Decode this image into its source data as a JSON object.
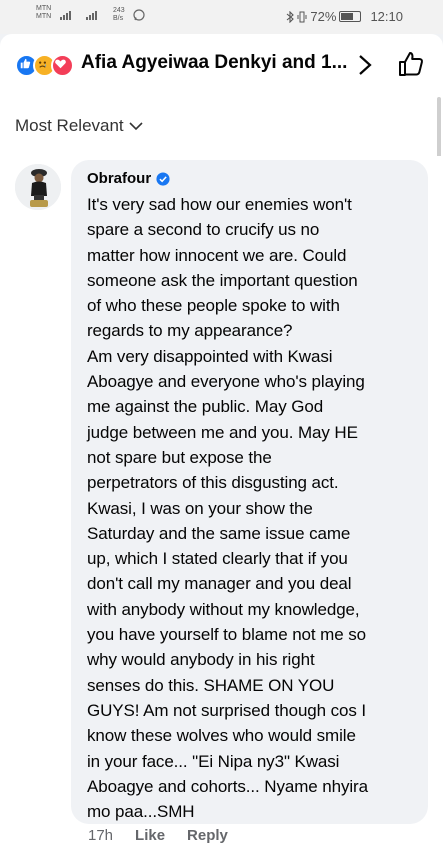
{
  "status_bar": {
    "carrier_top": "MTN",
    "carrier_bottom": "MTN",
    "data_speed_top": "243",
    "data_speed_bottom": "B/s",
    "battery_percent": "72%",
    "battery_level": 0.72,
    "time": "12:10"
  },
  "header": {
    "title": "Afia Agyeiwaa Denkyi and 1...",
    "reactions": [
      "like-icon",
      "sad-face-icon",
      "love-icon"
    ]
  },
  "sort": {
    "label": "Most Relevant"
  },
  "comment": {
    "author": "Obrafour",
    "verified": true,
    "lines": [
      "It's very sad how our enemies won't",
      "spare a second to crucify us  no",
      "matter how innocent we are. Could",
      "someone ask the important question",
      "of who these people spoke to with",
      "regards to my appearance?",
      "Am very disappointed with Kwasi",
      "Aboagye and everyone who's playing",
      "me against the public. May God",
      "judge between me and you. May HE",
      "not spare but expose the",
      "perpetrators of this disgusting act.",
      "Kwasi, I was on your show the",
      "Saturday and the same issue came",
      "up, which I stated clearly that if you",
      "don't call my manager and you deal",
      "with anybody without my knowledge,",
      "you have yourself to blame not me so",
      "why would anybody in his right",
      "senses do this. SHAME ON YOU",
      "GUYS! Am not surprised though cos I",
      "know these wolves who would smile",
      "in your face... \"Ei Nipa ny3\" Kwasi",
      "Aboagye and cohorts... Nyame nhyira",
      "mo paa...SMH"
    ],
    "time": "17h",
    "like_label": "Like",
    "reply_label": "Reply"
  },
  "colors": {
    "facebook_blue": "#1877f2",
    "bubble_bg": "#f0f2f5",
    "meta_grey": "#65676b"
  }
}
